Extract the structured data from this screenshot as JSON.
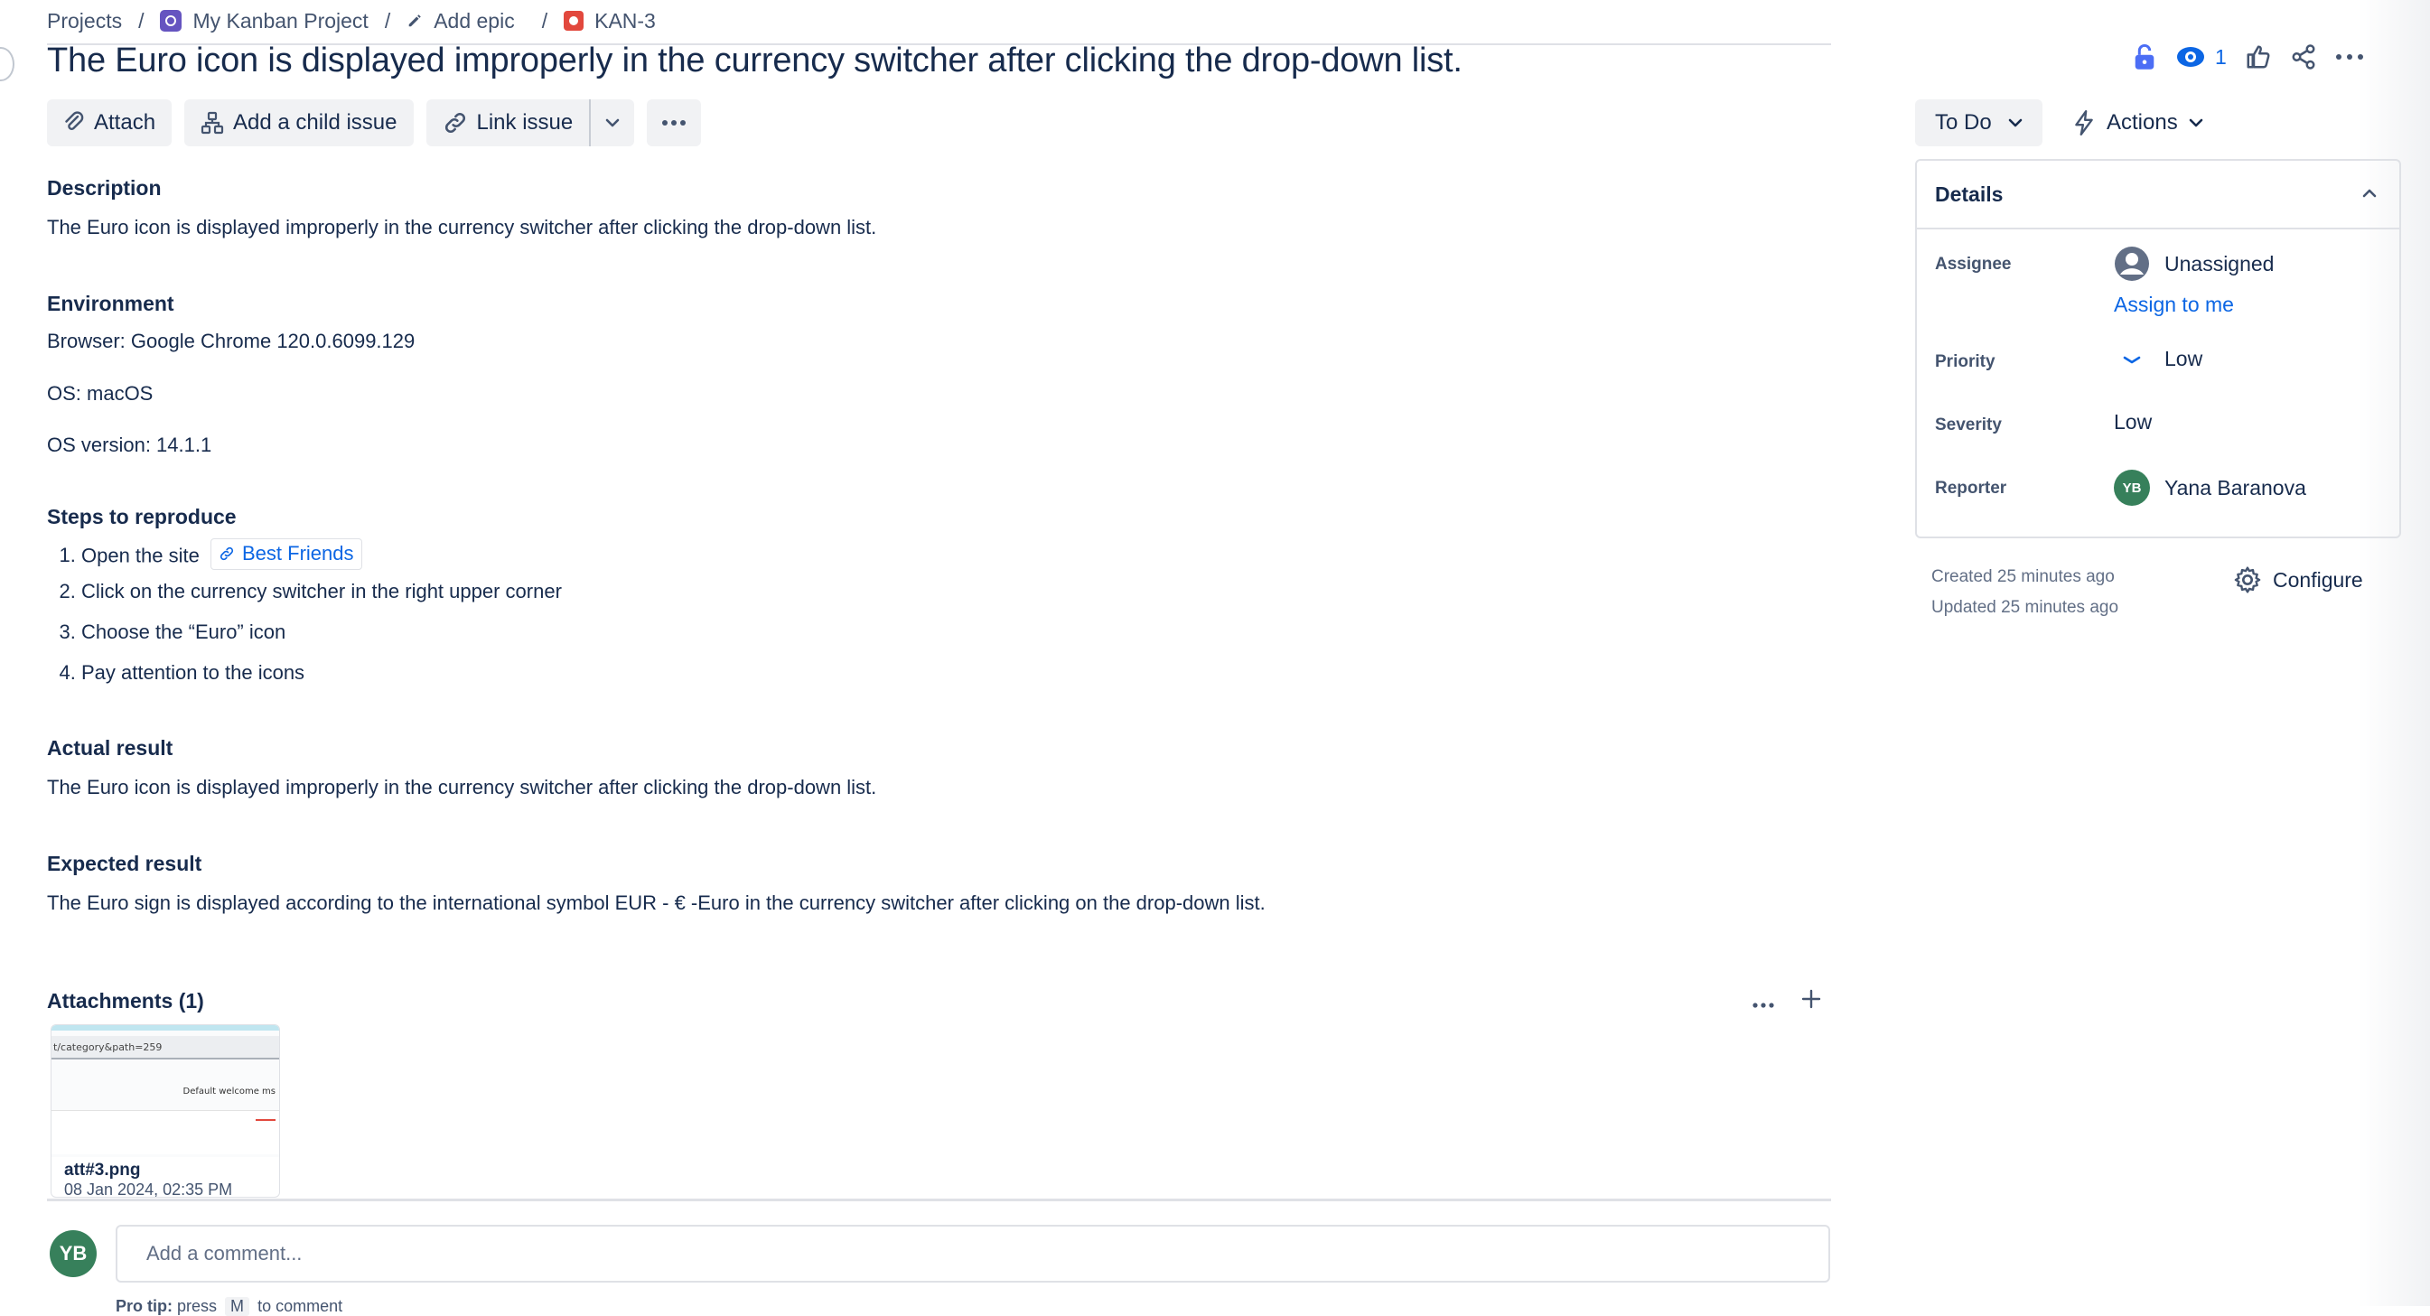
{
  "breadcrumb": {
    "projects": "Projects",
    "project": "My Kanban Project",
    "epic": "Add epic",
    "issue_key": "KAN-3",
    "separator": "/"
  },
  "issue": {
    "title": "The Euro icon is displayed improperly in the currency switcher after clicking the drop-down list."
  },
  "header_actions": {
    "watch_count": "1"
  },
  "toolbar": {
    "attach": "Attach",
    "add_child": "Add a child issue",
    "link_issue": "Link issue"
  },
  "description": {
    "heading": "Description",
    "text": "The Euro icon is displayed improperly in the currency switcher after clicking the drop-down list."
  },
  "environment": {
    "heading": "Environment",
    "browser": "Browser: Google Chrome 120.0.6099.129",
    "os": "OS: macOS",
    "os_version": "OS version: 14.1.1"
  },
  "steps": {
    "heading": "Steps to reproduce",
    "step1_prefix": "Open the site",
    "step1_link": "Best Friends",
    "step2": "Click on the currency switcher in the right upper corner",
    "step3": "Choose the “Euro” icon",
    "step4": "Pay attention to the icons"
  },
  "actual": {
    "heading": "Actual result",
    "text": "The Euro icon is displayed improperly in the currency switcher after clicking the drop-down list."
  },
  "expected": {
    "heading": "Expected result",
    "text": "The Euro sign is displayed according to the international symbol EUR - € -Euro in the currency switcher after clicking on the drop-down list."
  },
  "attachments": {
    "heading": "Attachments (1)",
    "file_name": "att#3.png",
    "file_date": "08 Jan 2024, 02:35 PM",
    "thumb_url": "t/category&path=259",
    "thumb_text": "Default welcome ms"
  },
  "comment": {
    "avatar_initials": "YB",
    "placeholder": "Add a comment...",
    "protip_label": "Pro tip:",
    "protip_press": "press",
    "protip_key": "M",
    "protip_suffix": "to comment"
  },
  "status": {
    "label": "To Do",
    "actions_label": "Actions"
  },
  "details": {
    "heading": "Details",
    "assignee_label": "Assignee",
    "assignee_value": "Unassigned",
    "assign_to_me": "Assign to me",
    "priority_label": "Priority",
    "priority_value": "Low",
    "severity_label": "Severity",
    "severity_value": "Low",
    "reporter_label": "Reporter",
    "reporter_initials": "YB",
    "reporter_value": "Yana Baranova"
  },
  "meta": {
    "created": "Created 25 minutes ago",
    "updated": "Updated 25 minutes ago",
    "configure": "Configure"
  },
  "colors": {
    "accent_blue": "#0c66e4",
    "avatar_green": "#37805b",
    "bug_red": "#e2483d",
    "project_purple": "#6554c0"
  }
}
